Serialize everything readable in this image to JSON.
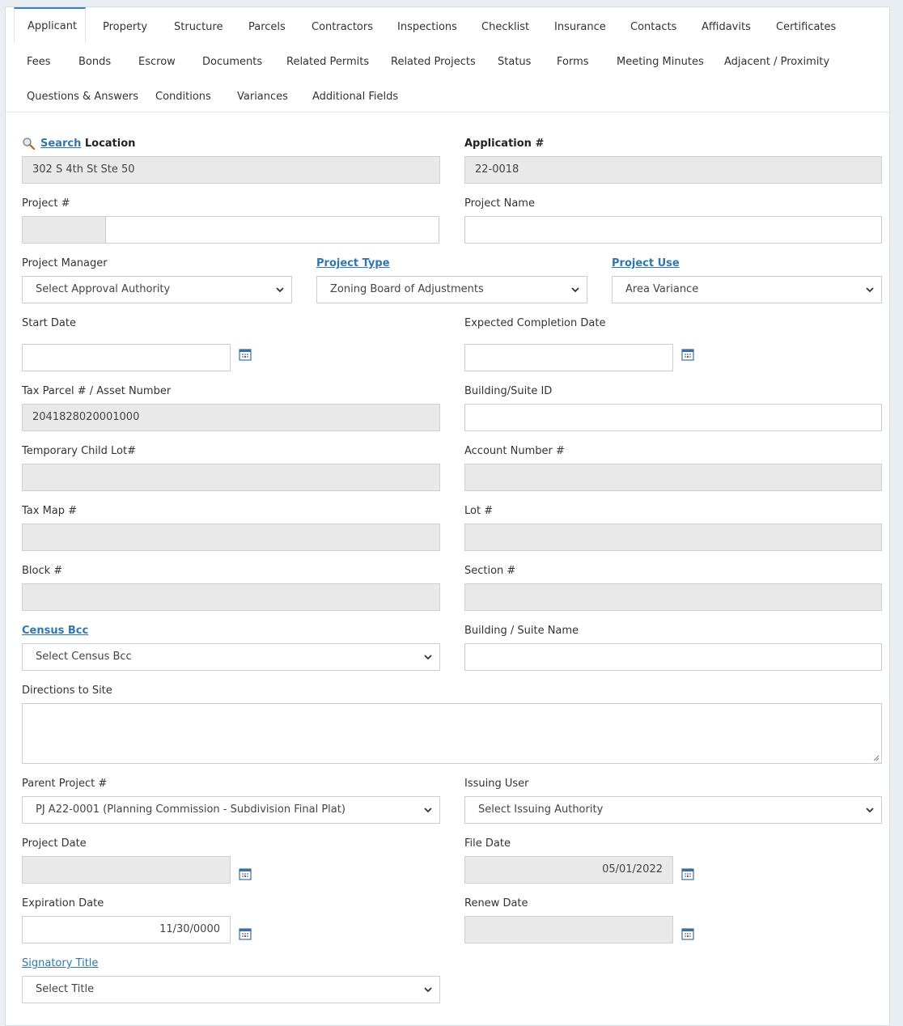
{
  "tabs": {
    "row1": [
      "Applicant",
      "Property",
      "Structure",
      "Parcels",
      "Contractors",
      "Inspections",
      "Checklist",
      "Insurance",
      "Contacts",
      "Affidavits",
      "Certificates"
    ],
    "row2": [
      "Fees",
      "Bonds",
      "Escrow",
      "Documents",
      "Related Permits",
      "Related Projects",
      "Status",
      "Forms",
      "Meeting Minutes",
      "Adjacent / Proximity"
    ],
    "row3": [
      "Questions & Answers",
      "Conditions",
      "Variances",
      "Additional Fields"
    ]
  },
  "form": {
    "location": {
      "search_link": "Search",
      "label": "Location",
      "value": "302 S 4th St Ste 50"
    },
    "application": {
      "label": "Application #",
      "value": "22-0018"
    },
    "project_num": {
      "label": "Project #",
      "prefix": "",
      "value": ""
    },
    "project_name": {
      "label": "Project Name",
      "value": ""
    },
    "project_manager": {
      "label": "Project Manager",
      "value": "Select Approval Authority"
    },
    "project_type": {
      "label": "Project Type",
      "value": "Zoning Board of Adjustments"
    },
    "project_use": {
      "label": "Project Use",
      "value": "Area Variance"
    },
    "start_date": {
      "label": "Start Date",
      "value": ""
    },
    "expected_completion": {
      "label": "Expected Completion Date",
      "value": ""
    },
    "tax_parcel": {
      "label": "Tax Parcel # / Asset Number",
      "value": "2041828020001000"
    },
    "building_suite_id": {
      "label": "Building/Suite ID",
      "value": ""
    },
    "temp_child_lot": {
      "label": "Temporary Child Lot#",
      "value": ""
    },
    "account_number": {
      "label": "Account Number #",
      "value": ""
    },
    "tax_map": {
      "label": "Tax Map #",
      "value": ""
    },
    "lot": {
      "label": "Lot #",
      "value": ""
    },
    "block": {
      "label": "Block #",
      "value": ""
    },
    "section": {
      "label": "Section #",
      "value": ""
    },
    "census_bcc": {
      "label": "Census Bcc",
      "value": "Select Census Bcc"
    },
    "building_suite_name": {
      "label": "Building / Suite Name",
      "value": ""
    },
    "directions": {
      "label": "Directions to Site",
      "value": ""
    },
    "parent_project": {
      "label": "Parent Project #",
      "value": "PJ A22-0001 (Planning Commission - Subdivision Final Plat)"
    },
    "issuing_user": {
      "label": "Issuing User",
      "value": "Select Issuing Authority"
    },
    "project_date": {
      "label": "Project Date",
      "value": ""
    },
    "file_date": {
      "label": "File Date",
      "value": "05/01/2022"
    },
    "expiration_date": {
      "label": "Expiration Date",
      "value": "11/30/0000"
    },
    "renew_date": {
      "label": "Renew Date",
      "value": ""
    },
    "signatory_title": {
      "label": "Signatory Title",
      "value": "Select Title"
    }
  },
  "colors": {
    "link": "#2f77b0",
    "readonly": "#e9e9e9",
    "accent": "#3d7fb8"
  },
  "icons": {
    "calendar": "calendar-icon",
    "search": "search-icon",
    "dropdown": "chevron-down-icon"
  }
}
